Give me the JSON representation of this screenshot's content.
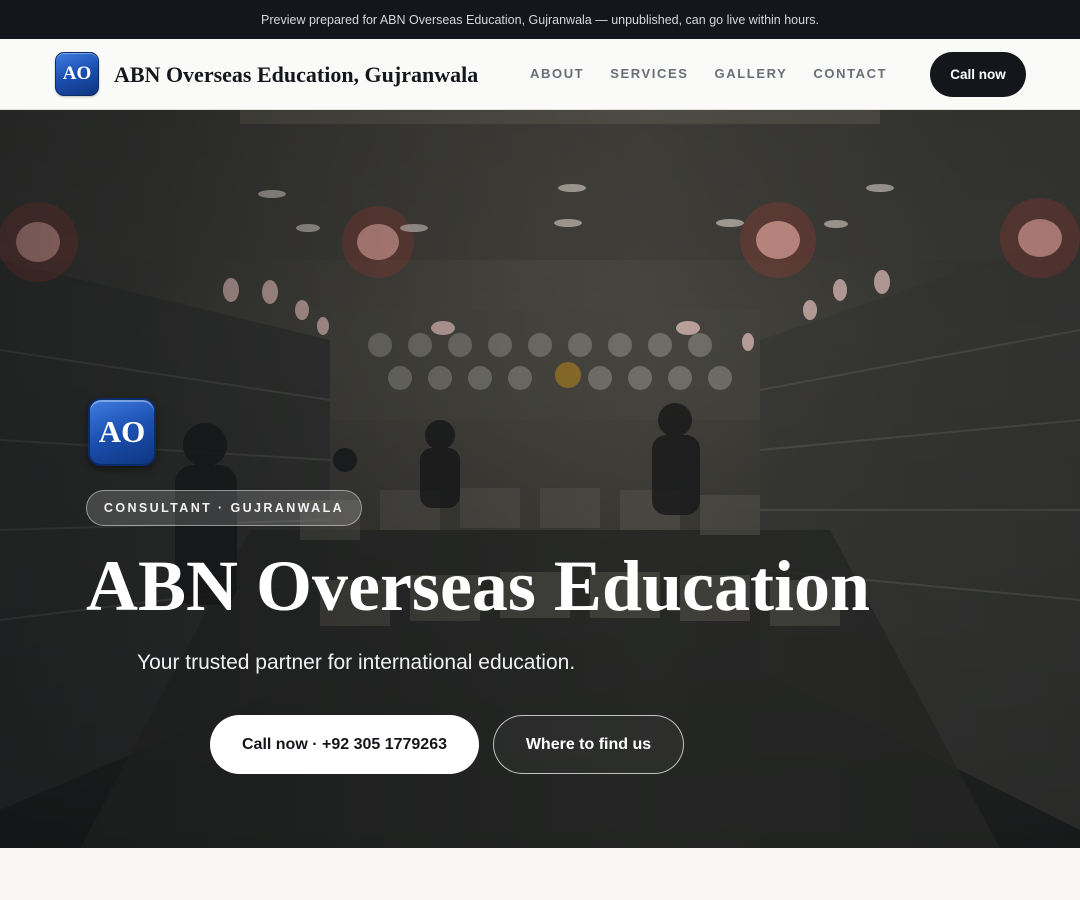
{
  "preview_bar": {
    "text": "Preview prepared for ABN Overseas Education, Gujranwala — unpublished, can go live within hours."
  },
  "header": {
    "logo_text": "AO",
    "brand_name": "ABN Overseas Education, Gujranwala",
    "nav": [
      {
        "label": "ABOUT"
      },
      {
        "label": "SERVICES"
      },
      {
        "label": "GALLERY"
      },
      {
        "label": "CONTACT"
      }
    ],
    "call_label": "Call now"
  },
  "hero": {
    "logo_text": "AO",
    "tag": "CONSULTANT · GUJRANWALA",
    "title": "ABN Overseas Education",
    "subtitle": "Your trusted partner for international education.",
    "primary_button": "Call now · +92 305 1779263",
    "secondary_button": "Where to find us"
  },
  "colors": {
    "dark": "#14161b",
    "logo_blue": "#1b4fb0",
    "page_bg": "#f8f7f4"
  }
}
